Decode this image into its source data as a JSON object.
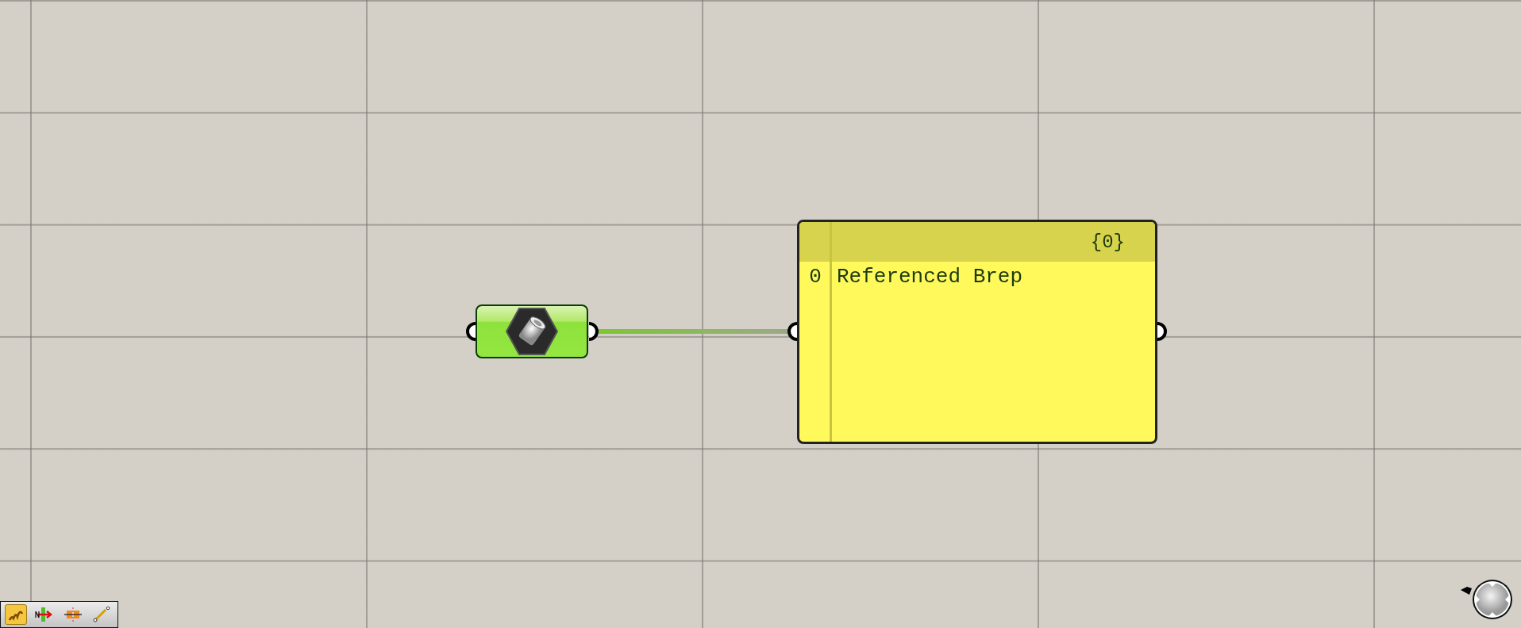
{
  "canvas": {
    "component": {
      "kind": "brep-parameter",
      "wired": true
    },
    "panel": {
      "path": "{0}",
      "items": [
        {
          "index": "0",
          "value": "Referenced Brep"
        }
      ]
    }
  },
  "toolbar": {
    "buttons": [
      {
        "kind": "canvas-style",
        "selected": true
      },
      {
        "kind": "name-arrow",
        "selected": false
      },
      {
        "kind": "split",
        "selected": false
      },
      {
        "kind": "wire-pin",
        "selected": false
      }
    ]
  }
}
